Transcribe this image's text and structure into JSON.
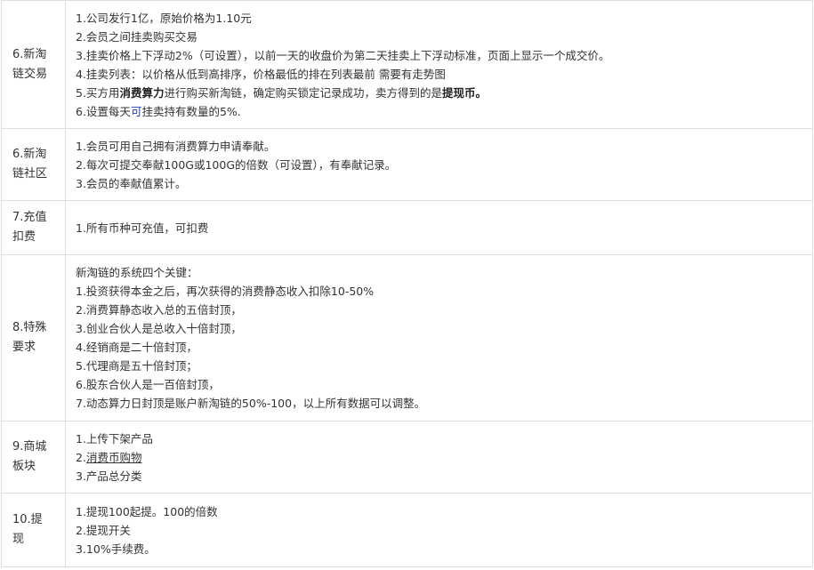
{
  "rows": [
    {
      "label": [
        "6.新淘",
        "链交易"
      ],
      "lines": {
        "l1": "1.公司发行1亿，原始价格为1.10元",
        "l2": "2.会员之间挂卖购买交易",
        "l3": "3.挂卖价格上下浮动2%（可设置），以前一天的收盘价为第二天挂卖上下浮动标准，页面上显示一个成交价。",
        "l4": "4.挂卖列表：以价格从低到高排序，价格最低的排在列表最前   需要有走势图",
        "l5_a": "5.买方用",
        "l5_b": "消费算力",
        "l5_c": "进行购买新淘链，确定购买锁定记录成功，卖方得到的是",
        "l5_d": "提现币。",
        "l6_a": "6.设置每天",
        "l6_b": "可",
        "l6_c": "挂卖持有数量的5%."
      }
    },
    {
      "label": [
        "6.新淘",
        "链社区"
      ],
      "lines": [
        "1.会员可用自己拥有消费算力申请奉献。",
        "2.每次可提交奉献100G或100G的倍数（可设置），有奉献记录。",
        "3.会员的奉献值累计。"
      ]
    },
    {
      "label": [
        "7.充值",
        "扣费"
      ],
      "lines": [
        "1.所有币种可充值，可扣费"
      ]
    },
    {
      "label": [
        "8.特殊",
        "要求"
      ],
      "lines": [
        "新淘链的系统四个关键：",
        "1.投资获得本金之后，再次获得的消费静态收入扣除10-50%",
        "2.消费算静态收入总的五倍封顶，",
        "3.创业合伙人是总收入十倍封顶，",
        "4.经销商是二十倍封顶，",
        "5.代理商是五十倍封顶；",
        "6.股东合伙人是一百倍封顶，",
        "7.动态算力日封顶是账户新淘链的50%-100，以上所有数据可以调整。"
      ]
    },
    {
      "label": [
        "9.商城",
        "板块"
      ],
      "lines": {
        "l1": "1.上传下架产品",
        "l2_a": "2.",
        "l2_b": "消费币购物",
        "l3": "3.产品总分类"
      }
    },
    {
      "label": [
        "10.提",
        "现"
      ],
      "lines": [
        "1.提现100起提。100的倍数",
        "2.提现开关",
        "3.10%手续费。"
      ]
    }
  ]
}
